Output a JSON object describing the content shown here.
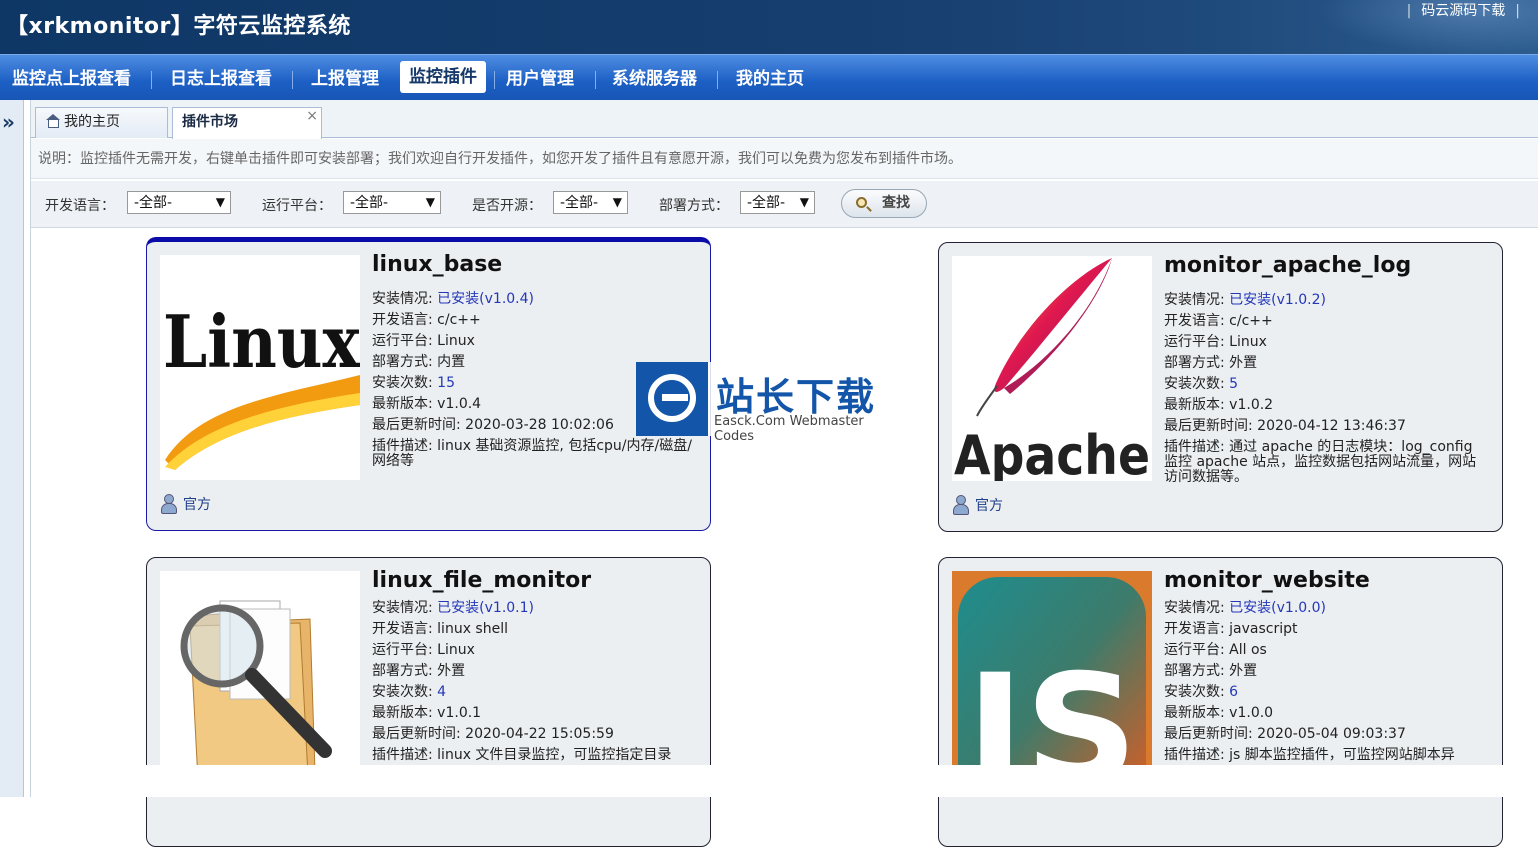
{
  "header": {
    "title": "【xrkmonitor】字符云监控系统",
    "download_link": "码云源码下载"
  },
  "nav": {
    "items": [
      {
        "label": "监控点上报查看"
      },
      {
        "label": "日志上报查看"
      },
      {
        "label": "上报管理"
      },
      {
        "label": "监控插件"
      },
      {
        "label": "用户管理"
      },
      {
        "label": "系统服务器"
      },
      {
        "label": "我的主页"
      }
    ],
    "active": "监控插件"
  },
  "sidebar": {
    "expand_icon": "double-chevron-right-icon",
    "expand_glyph": "»"
  },
  "tabs": {
    "home": "我的主页",
    "market": "插件市场",
    "close_glyph": "×"
  },
  "description": "说明：监控插件无需开发，右键单击插件即可安装部署；我们欢迎自行开发插件，如您开发了插件且有意愿开源，我们可以免费为您发布到插件市场。",
  "filters": {
    "lang_label": "开发语言：",
    "lang_value": "-全部-",
    "platform_label": "运行平台：",
    "platform_value": "-全部-",
    "opensource_label": "是否开源：",
    "opensource_value": "-全部-",
    "deploy_label": "部署方式：",
    "deploy_value": "-全部-",
    "search_label": "查找"
  },
  "labels": {
    "install_status": "安装情况: ",
    "language": "开发语言: ",
    "platform": "运行平台: ",
    "deploy": "部署方式: ",
    "install_count": "安装次数: ",
    "latest_version": "最新版本: ",
    "last_update": "最后更新时间: ",
    "plugin_desc": "插件描述: "
  },
  "plugins": [
    {
      "name": "linux_base",
      "status": "已安装(v1.0.4)",
      "language": "c/c++",
      "platform": "Linux",
      "deploy": "内置",
      "installs": "15",
      "version": "v1.0.4",
      "updated": "2020-03-28 10:02:06",
      "desc": "linux 基础资源监控, 包括cpu/内存/磁盘/网络等",
      "author": "官方",
      "logo_text": "Linux"
    },
    {
      "name": "monitor_apache_log",
      "status": "已安装(v1.0.2)",
      "language": "c/c++",
      "platform": "Linux",
      "deploy": "外置",
      "installs": "5",
      "version": "v1.0.2",
      "updated": "2020-04-12 13:46:37",
      "desc": "通过 apache 的日志模块：log_config 监控 apache 站点，监控数据包括网站流量，网站访问数据等。",
      "author": "官方",
      "logo_text": "Apache"
    },
    {
      "name": "linux_file_monitor",
      "status": "已安装(v1.0.1)",
      "language": "linux shell",
      "platform": "Linux",
      "deploy": "外置",
      "installs": "4",
      "version": "v1.0.1",
      "updated": "2020-04-22 15:05:59",
      "desc": "linux 文件目录监控，可监控指定目录",
      "author": "",
      "logo_text": ""
    },
    {
      "name": "monitor_website",
      "status": "已安装(v1.0.0)",
      "language": "javascript",
      "platform": "All  os",
      "deploy": "外置",
      "installs": "6",
      "version": "v1.0.0",
      "updated": "2020-05-04 09:03:37",
      "desc": "js 脚本监控插件，可监控网站脚本异",
      "author": "",
      "logo_text": "JS"
    }
  ],
  "watermark": {
    "main": "站长下载",
    "sub": "Easck.Com Webmaster Codes"
  },
  "colors": {
    "header_bg": "#163e6e",
    "nav_bg": "#1c5fc4",
    "link": "#2437b8",
    "selected_border": "#0b0ba8"
  }
}
